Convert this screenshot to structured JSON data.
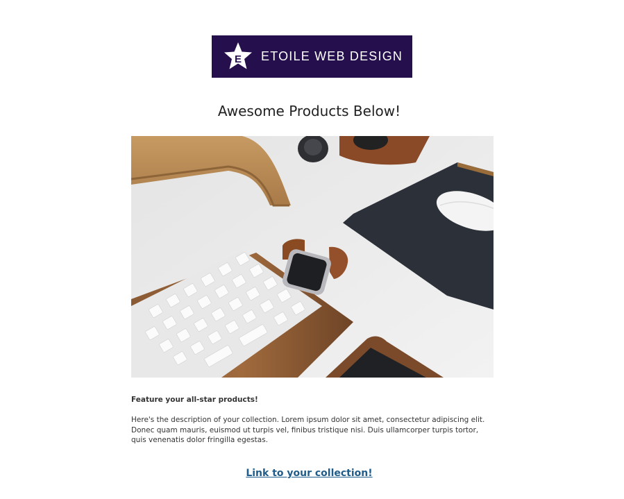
{
  "header": {
    "logo_text": "ETOILE WEB DESIGN",
    "logo_letter": "E",
    "logo_bg_color": "#25104d"
  },
  "main": {
    "headline": "Awesome Products Below!",
    "hero_image": {
      "icon": "product-photo"
    },
    "feature_title": "Feature your all-star products!",
    "description": "Here's the description of your collection. Lorem ipsum dolor sit amet, consectetur adipiscing elit. Donec quam mauris, euismod ut turpis vel, finibus tristique nisi. Duis ullamcorper turpis tortor, quis venenatis dolor fringilla egestas.",
    "cta_label": "Link to your collection!",
    "cta_color": "#1f5c8b"
  }
}
